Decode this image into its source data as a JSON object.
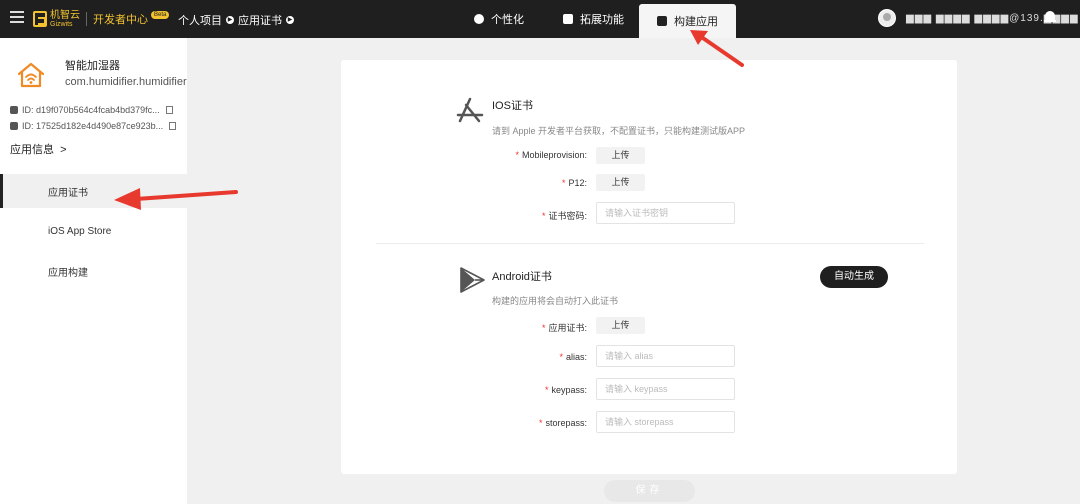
{
  "topbar": {
    "logo_cn": "机智云",
    "logo_en": "Gizwits",
    "dev_center": "开发者中心",
    "beta": "Beta",
    "crumbs": [
      "个人项目",
      "应用证书"
    ],
    "tabs": [
      {
        "label": "个性化",
        "icon": "palette-icon"
      },
      {
        "label": "拓展功能",
        "icon": "extension-icon"
      },
      {
        "label": "构建应用",
        "icon": "build-icon",
        "active": true
      }
    ],
    "username": "▆▆▆ ▆▆▆▆ ▆▆▆▆@139.▆▆▆▆"
  },
  "sidebar": {
    "app_name": "智能加湿器",
    "app_package": "com.humidifier.humidifier",
    "ios_id_label": "ID:",
    "ios_id": "d19f070b564c4fcab4bd379fc...",
    "android_id_label": "ID:",
    "android_id": "17525d182e4d490e87ce923b...",
    "app_info": "应用信息",
    "nav": [
      {
        "label": "应用证书",
        "active": true
      },
      {
        "label": "iOS App Store"
      },
      {
        "label": "应用构建"
      }
    ]
  },
  "ios": {
    "title": "IOS证书",
    "desc": "请到 Apple 开发者平台获取，不配置证书，只能构建测试版APP",
    "mobileprovision_label": "Mobileprovision:",
    "p12_label": "P12:",
    "password_label": "证书密码:",
    "password_placeholder": "请输入证书密钥",
    "upload_label": "上传"
  },
  "android": {
    "title": "Android证书",
    "desc": "构建的应用将会自动打入此证书",
    "auto_generate": "自动生成",
    "cert_label": "应用证书:",
    "alias_label": "alias:",
    "alias_placeholder": "请输入 alias",
    "keypass_label": "keypass:",
    "keypass_placeholder": "请输入 keypass",
    "storepass_label": "storepass:",
    "storepass_placeholder": "请输入 storepass",
    "upload_label": "上传"
  },
  "save_label": "保存",
  "colors": {
    "accent": "#f2c230",
    "dark": "#1f1f1f",
    "required": "#e33333",
    "annotation": "#e8392e"
  }
}
